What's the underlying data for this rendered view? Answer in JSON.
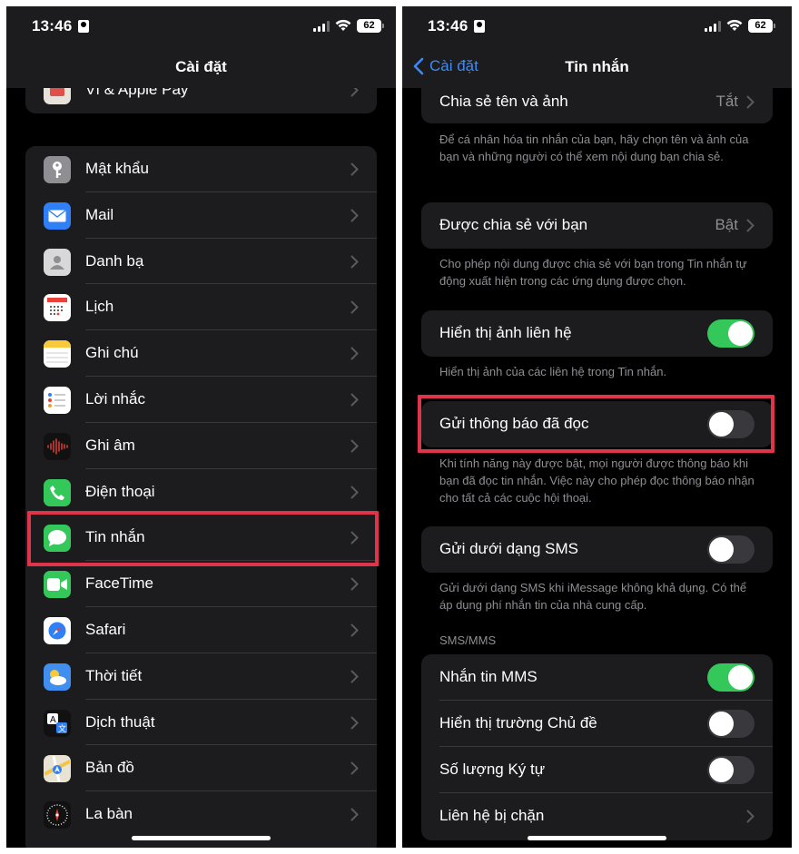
{
  "left": {
    "status": {
      "time": "13:46",
      "battery": "62"
    },
    "nav_title": "Cài đặt",
    "partial_row": "Ví & Apple Pay",
    "items": [
      {
        "label": "Mật khẩu",
        "icon": "key-icon",
        "color": "#8e8e93"
      },
      {
        "label": "Mail",
        "icon": "envelope-icon",
        "color": "#2f7ff7"
      },
      {
        "label": "Danh bạ",
        "icon": "contacts-icon",
        "color": "#c8c8c8"
      },
      {
        "label": "Lịch",
        "icon": "calendar-icon",
        "color": "#ffffff"
      },
      {
        "label": "Ghi chú",
        "icon": "notes-icon",
        "color": "#ffffff"
      },
      {
        "label": "Lời nhắc",
        "icon": "reminders-icon",
        "color": "#ffffff"
      },
      {
        "label": "Ghi âm",
        "icon": "voice-memo-icon",
        "color": "#1c1c1e"
      },
      {
        "label": "Điện thoại",
        "icon": "phone-icon",
        "color": "#34c759"
      },
      {
        "label": "Tin nhắn",
        "icon": "messages-icon",
        "color": "#34c759"
      },
      {
        "label": "FaceTime",
        "icon": "video-camera-icon",
        "color": "#34c759"
      },
      {
        "label": "Safari",
        "icon": "compass-icon",
        "color": "#2f7ff7"
      },
      {
        "label": "Thời tiết",
        "icon": "weather-icon",
        "color": "#3f8ef0"
      },
      {
        "label": "Dịch thuật",
        "icon": "translate-icon",
        "color": "#1c1c1e"
      },
      {
        "label": "Bản đồ",
        "icon": "map-icon",
        "color": "#5ec96a"
      },
      {
        "label": "La bàn",
        "icon": "compass-dial-icon",
        "color": "#1c1c1e"
      }
    ]
  },
  "right": {
    "status": {
      "time": "13:46",
      "battery": "62"
    },
    "back_label": "Cài đặt",
    "nav_title": "Tin nhắn",
    "share_name": {
      "label": "Chia sẻ tên và ảnh",
      "value": "Tắt"
    },
    "share_name_footer": "Để cá nhân hóa tin nhắn của bạn, hãy chọn tên và ảnh của bạn và những người có thể xem nội dung bạn chia sẻ.",
    "shared_with_you": {
      "label": "Được chia sẻ với bạn",
      "value": "Bật"
    },
    "shared_with_you_footer": "Cho phép nội dung được chia sẻ với bạn trong Tin nhắn tự động xuất hiện trong các ứng dụng được chọn.",
    "show_contact_photos": {
      "label": "Hiển thị ảnh liên hệ",
      "on": true
    },
    "show_contact_photos_footer": "Hiển thị ảnh của các liên hệ trong Tin nhắn.",
    "read_receipts": {
      "label": "Gửi thông báo đã đọc",
      "on": false
    },
    "read_receipts_footer": "Khi tính năng này được bật, mọi người được thông báo khi bạn đã đọc tin nhắn. Việc này cho phép đọc thông báo nhận cho tất cả các cuộc hội thoại.",
    "send_as_sms": {
      "label": "Gửi dưới dạng SMS",
      "on": false
    },
    "send_as_sms_footer": "Gửi dưới dạng SMS khi iMessage không khả dụng. Có thể áp dụng phí nhắn tin của nhà cung cấp.",
    "sms_header": "SMS/MMS",
    "sms_rows": [
      {
        "label": "Nhắn tin MMS",
        "on": true
      },
      {
        "label": "Hiển thị trường Chủ đề",
        "on": false
      },
      {
        "label": "Số lượng Ký tự",
        "on": false
      }
    ],
    "blocked": {
      "label": "Liên hệ bị chặn"
    }
  },
  "colors": {
    "highlight": "#e0344a",
    "accent": "#3c8bf5",
    "toggle_on": "#34c759"
  }
}
